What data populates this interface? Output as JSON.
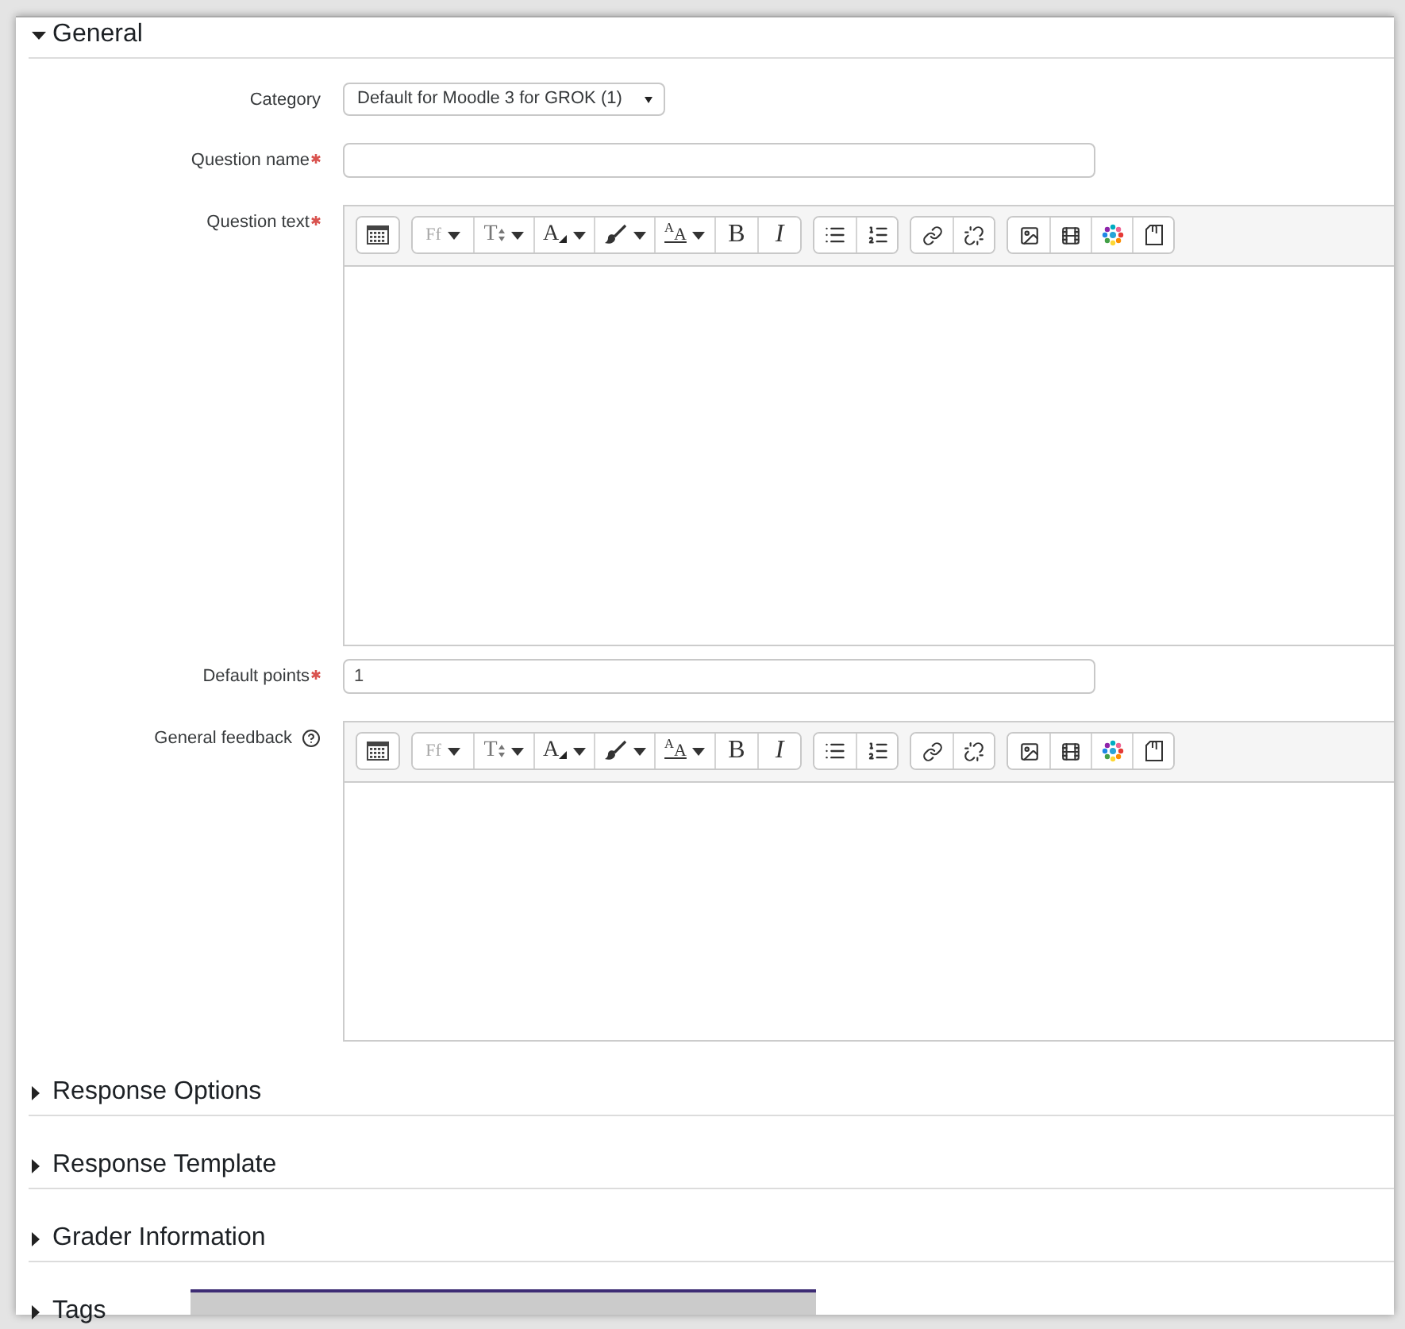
{
  "sections": [
    {
      "title": "General",
      "expanded": true,
      "fields": [
        {
          "kind": "select",
          "label": "Category",
          "required": false,
          "help": false,
          "value": "Default for Moodle 3 for GROK (1)"
        },
        {
          "kind": "text",
          "label": "Question name",
          "required": true,
          "help": false
        },
        {
          "kind": "editor",
          "label": "Question text",
          "required": true,
          "help": false,
          "toolbar": [
            [
              {
                "kind": "keyboard",
                "dropdown": false
              }
            ],
            [
              {
                "kind": "font_family",
                "label": "Ff",
                "dropdown": true
              },
              {
                "kind": "font_size",
                "label": "T",
                "dropdown": true
              },
              {
                "kind": "font_color",
                "label": "A",
                "dropdown": true
              },
              {
                "kind": "highlight",
                "dropdown": true
              },
              {
                "kind": "text_style",
                "label": "$^{A}$A",
                "dropdown": true
              },
              {
                "kind": "bold",
                "label": "B",
                "dropdown": false
              },
              {
                "kind": "italic",
                "label": "I",
                "dropdown": false
              }
            ],
            [
              {
                "kind": "bullets",
                "dropdown": false
              },
              {
                "kind": "numbers",
                "dropdown": false
              }
            ],
            [
              {
                "kind": "link",
                "dropdown": false
              },
              {
                "kind": "unlink",
                "dropdown": false
              }
            ],
            [
              {
                "kind": "image",
                "dropdown": false
              },
              {
                "kind": "video",
                "dropdown": false
              },
              {
                "kind": "media",
                "dropdown": false
              },
              {
                "kind": "file",
                "dropdown": false
              }
            ]
          ]
        },
        {
          "kind": "text",
          "label": "Default points",
          "required": true,
          "help": false,
          "value": "1"
        },
        {
          "kind": "editor",
          "label": "General feedback",
          "required": false,
          "help": true,
          "toolbar": [
            [
              {
                "kind": "keyboard",
                "dropdown": false
              }
            ],
            [
              {
                "kind": "font_family",
                "label": "Ff",
                "dropdown": true
              },
              {
                "kind": "font_size",
                "label": "T",
                "dropdown": true
              },
              {
                "kind": "font_color",
                "label": "A",
                "dropdown": true
              },
              {
                "kind": "highlight",
                "dropdown": true
              },
              {
                "kind": "text_style",
                "label": "$^{A}$A",
                "dropdown": true
              },
              {
                "kind": "bold",
                "label": "B",
                "dropdown": false
              },
              {
                "kind": "italic",
                "label": "I",
                "dropdown": false
              }
            ],
            [
              {
                "kind": "bullets",
                "dropdown": false
              },
              {
                "kind": "numbers",
                "dropdown": false
              }
            ],
            [
              {
                "kind": "link",
                "dropdown": false
              },
              {
                "kind": "unlink",
                "dropdown": false
              }
            ],
            [
              {
                "kind": "image",
                "dropdown": false
              },
              {
                "kind": "video",
                "dropdown": false
              },
              {
                "kind": "media",
                "dropdown": false
              },
              {
                "kind": "file",
                "dropdown": false
              }
            ]
          ]
        }
      ]
    },
    {
      "title": "Response Options",
      "expanded": false
    },
    {
      "title": "Response Template",
      "expanded": false
    },
    {
      "title": "Grader Information",
      "expanded": false
    },
    {
      "title": "Tags",
      "expanded": false
    }
  ]
}
